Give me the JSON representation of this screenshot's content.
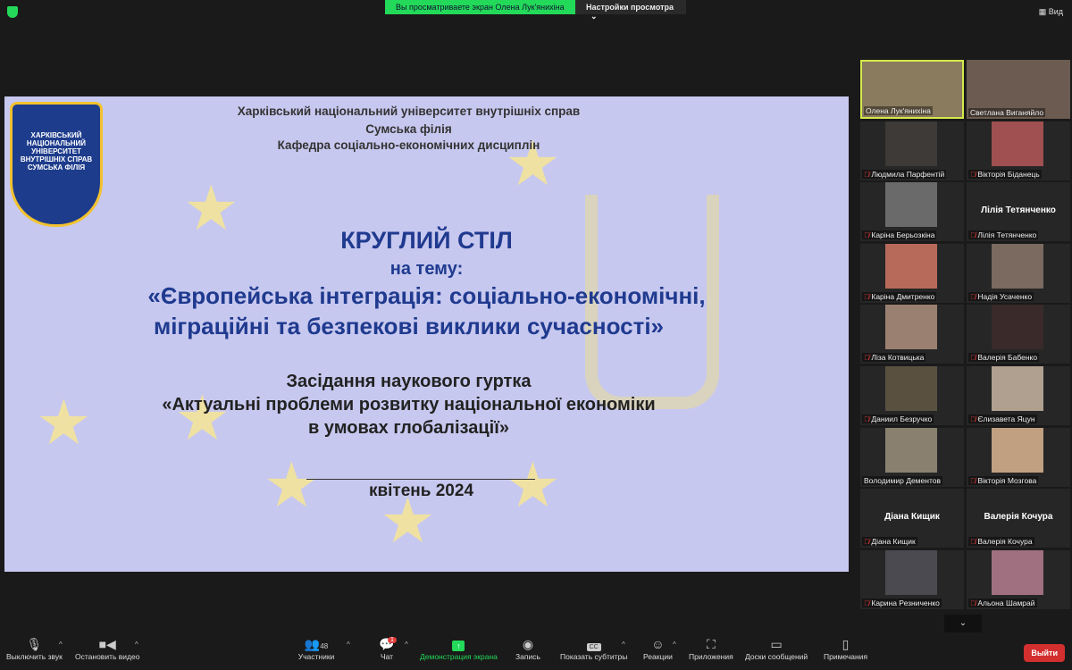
{
  "top": {
    "banner": "Вы просматриваете экран Олена Лук'янихіна",
    "view_options": "Настройки просмотра",
    "view": "Вид"
  },
  "slide": {
    "logo_text": "ХАРКІВСЬКИЙ НАЦІОНАЛЬНИЙ УНІВЕРСИТЕТ ВНУТРІШНІХ СПРАВ СУМСЬКА ФІЛІЯ",
    "line1": "Харківський національний університет внутрішніх справ",
    "line2": "Сумська філія",
    "line3": "Кафедра соціально-економічних дисциплін",
    "title": "КРУГЛИЙ СТІЛ",
    "subtitle": "на тему:",
    "topic1": "«Європейська інтеграція: соціально-економічні,",
    "topic2": "міграційні та безпекові виклики сучасності»",
    "meeting": "Засідання наукового гуртка",
    "circle1": "«Актуальні проблеми розвитку національної економіки",
    "circle2": "в умовах глобалізації»",
    "date": "квітень 2024"
  },
  "participants": [
    {
      "name": "Олена Лук'янихіна",
      "video": true,
      "muted": false,
      "active": true
    },
    {
      "name": "Светлана Виганяйло",
      "video": true,
      "muted": false
    },
    {
      "name": "Людмила Парфентій",
      "video": true,
      "muted": true
    },
    {
      "name": "Вікторія Біданець",
      "video": true,
      "muted": true
    },
    {
      "name": "Каріна Берьозкіна",
      "video": true,
      "muted": true
    },
    {
      "name": "Лілія Тетянченко",
      "video": false,
      "muted": true
    },
    {
      "name": "Каріна Дмитренко",
      "video": true,
      "muted": true
    },
    {
      "name": "Надія Усаченко",
      "video": true,
      "muted": true
    },
    {
      "name": "Ліза Котвицька",
      "video": true,
      "muted": true
    },
    {
      "name": "Валерія Бабенко",
      "video": true,
      "muted": true
    },
    {
      "name": "Даниил Безручко",
      "video": true,
      "muted": true
    },
    {
      "name": "Єлизавета Яцун",
      "video": true,
      "muted": true
    },
    {
      "name": "Володимир Дементов",
      "video": true,
      "muted": false
    },
    {
      "name": "Вікторія Мозгова",
      "video": true,
      "muted": true
    },
    {
      "name": "Діана Кищик",
      "video": false,
      "muted": true
    },
    {
      "name": "Валерія Кочура",
      "video": false,
      "muted": true
    },
    {
      "name": "Карина Резниченко",
      "video": true,
      "muted": true
    },
    {
      "name": "Альона Шамрай",
      "video": true,
      "muted": true
    }
  ],
  "toolbar": {
    "mute": "Выключить звук",
    "video": "Остановить видео",
    "participants": "Участники",
    "participants_count": "48",
    "chat": "Чат",
    "chat_badge": "1",
    "share": "Демонстрация экрана",
    "record": "Запись",
    "captions": "Показать субтитры",
    "cc": "CC",
    "reactions": "Реакции",
    "apps": "Приложения",
    "whiteboards": "Доски сообщений",
    "notes": "Примечания",
    "leave": "Выйти"
  }
}
